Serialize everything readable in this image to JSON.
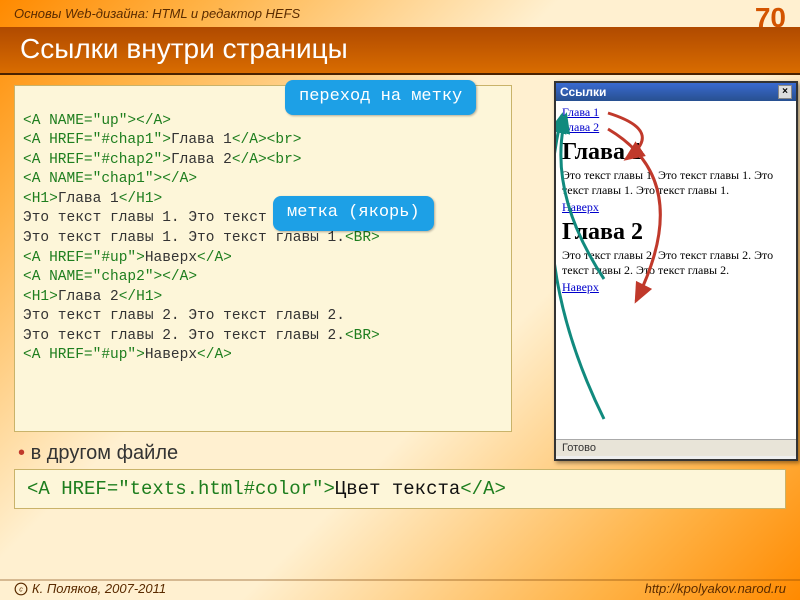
{
  "header": {
    "breadcrumb": "Основы Web-дизайна: HTML и редактор HEFS",
    "pagenum": "70"
  },
  "title": "Ссылки внутри страницы",
  "callouts": {
    "c1": "переход на метку",
    "c2": "метка (якорь)"
  },
  "code": {
    "l1a": "<A NAME=\"up\">",
    "l1b": "</A>",
    "l2a": "<A HREF=\"#chap1\">",
    "l2b": "Глава 1",
    "l2c": "</A><br>",
    "l3a": "<A HREF=\"#chap2\">",
    "l3b": "Глава 2",
    "l3c": "</A><br>",
    "l4a": "<A NAME=\"chap1\">",
    "l4b": "</A>",
    "l5a": "<H1>",
    "l5b": "Глава 1",
    "l5c": "</H1>",
    "l6": "Это текст главы 1. Это текст главы 1.",
    "l7a": "Это текст главы 1. Это текст главы 1.",
    "l7b": "<BR>",
    "l8a": "<A HREF=\"#up\">",
    "l8b": "Наверх",
    "l8c": "</A>",
    "l9a": "<A NAME=\"chap2\">",
    "l9b": "</A>",
    "l10a": "<H1>",
    "l10b": "Глава 2",
    "l10c": "</H1>",
    "l11": "Это текст главы 2. Это текст главы 2.",
    "l12a": "Это текст главы 2. Это текст главы 2.",
    "l12b": "<BR>",
    "l13a": "<A HREF=\"#up\">",
    "l13b": "Наверх",
    "l13c": "</A>"
  },
  "bullet": "в другом файле",
  "code2": {
    "a": "<A HREF=\"texts.html#color\">",
    "b": "Цвет текста",
    "c": "</A>"
  },
  "mini": {
    "title": "Ссылки",
    "link1": "Глава 1",
    "link2": "Глава 2",
    "h1": "Глава 1",
    "p1": "Это текст главы 1. Это текст главы 1. Это текст главы 1. Это текст главы 1.",
    "up": "Наверх",
    "h2": "Глава 2",
    "p2": "Это текст главы 2. Это текст главы 2. Это текст главы 2. Это текст главы 2.",
    "status": "Готово"
  },
  "footer": {
    "author": "К. Поляков, 2007-2011",
    "url": "http://kpolyakov.narod.ru"
  }
}
